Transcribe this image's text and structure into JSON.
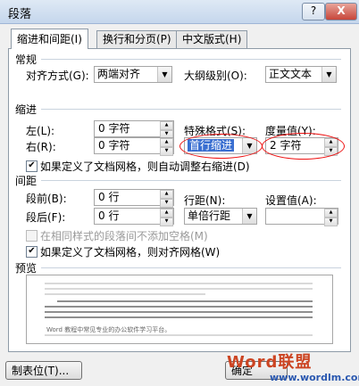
{
  "window": {
    "title": "段落",
    "help_label": "?",
    "close_label": "X"
  },
  "tabs": [
    {
      "label": "缩进和间距(I)"
    },
    {
      "label": "换行和分页(P)"
    },
    {
      "label": "中文版式(H)"
    }
  ],
  "general": {
    "heading": "常规",
    "alignment_label": "对齐方式(G):",
    "alignment_value": "两端对齐",
    "outline_label": "大纲级别(O):",
    "outline_value": "正文文本"
  },
  "indent": {
    "heading": "缩进",
    "left_label": "左(L):",
    "left_value": "0 字符",
    "right_label": "右(R):",
    "right_value": "0 字符",
    "special_label": "特殊格式(S):",
    "special_value": "首行缩进",
    "measure_label": "度量值(Y):",
    "measure_value": "2 字符",
    "grid_checkbox": "如果定义了文档网格，则自动调整右缩进(D)"
  },
  "spacing": {
    "heading": "间距",
    "before_label": "段前(B):",
    "before_value": "0 行",
    "after_label": "段后(F):",
    "after_value": "0 行",
    "line_label": "行距(N):",
    "line_value": "单倍行距",
    "setting_label": "设置值(A):",
    "setting_value": "",
    "same_style_checkbox": "在相同样式的段落间不添加空格(M)",
    "grid_align_checkbox": "如果定义了文档网格，则对齐网格(W)"
  },
  "preview": {
    "heading": "预览",
    "sample_text": "Word 教程中常见专业的办公软件学习平台。"
  },
  "buttons": {
    "tabs_label": "制表位(T)...",
    "ok_label": "确定"
  },
  "watermark": {
    "text": "Word联盟",
    "url": "www.wordlm.com"
  }
}
